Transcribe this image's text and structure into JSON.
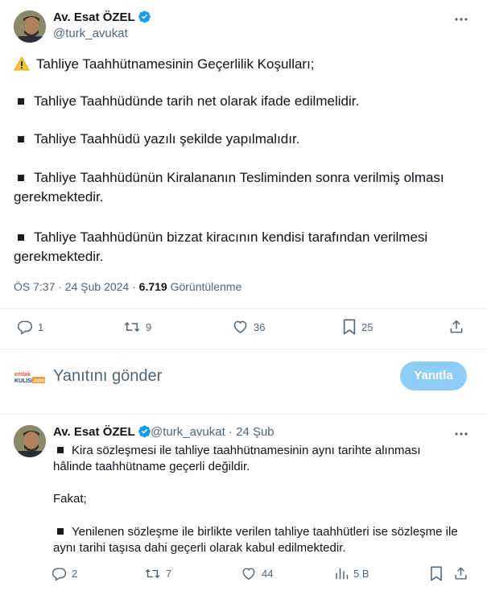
{
  "tweet": {
    "author_name": "Av. Esat ÖZEL",
    "handle": "@turk_avukat",
    "lines": [
      "Tahliye Taahhütnamesinin Geçerlilik Koşulları;",
      "Tahliye Taahhüdünde tarih net olarak ifade edilmelidir.",
      "Tahliye Taahhüdü yazılı şekilde yapılmalıdır.",
      "Tahliye Taahhüdünün Kiralananın Tesliminden sonra verilmiş olması",
      "gerekmektedir.",
      "Tahliye Taahhüdünün bizzat kiracının kendisi tarafından verilmesi",
      "gerekmektedir."
    ],
    "time": "ÖS 7:37 · 24 Şub 2024 ·",
    "views_count": "6.719",
    "views_label": "Görüntülenme",
    "stats": {
      "replies": "1",
      "retweets": "9",
      "likes": "36",
      "bookmarks": "25"
    }
  },
  "composer": {
    "placeholder": "Yanıtını gönder",
    "button_label": "Yanıtla",
    "logo_text_top": "emlak",
    "logo_text_bottom": "KULISI",
    "logo_tag": ".com"
  },
  "reply": {
    "author_name": "Av. Esat ÖZEL",
    "handle": "@turk_avukat · 24 Şub",
    "lines": [
      "Kira sözleşmesi ile tahliye taahhütnamesinin aynı tarihte alınması",
      "hâlinde taahhütname geçerli değildir.",
      "Fakat;",
      "Yenilenen sözleşme ile birlikte verilen tahliye taahhütleri ise sözleşme ile",
      "aynı tarihi taşısa dahi geçerli olarak kabul edilmektedir."
    ],
    "stats": {
      "replies": "2",
      "retweets": "7",
      "likes": "44",
      "views": "5 B"
    }
  },
  "colors": {
    "accent": "#1d9bf0",
    "button_disabled": "#8ecdf8",
    "secondary_text": "#536471"
  }
}
